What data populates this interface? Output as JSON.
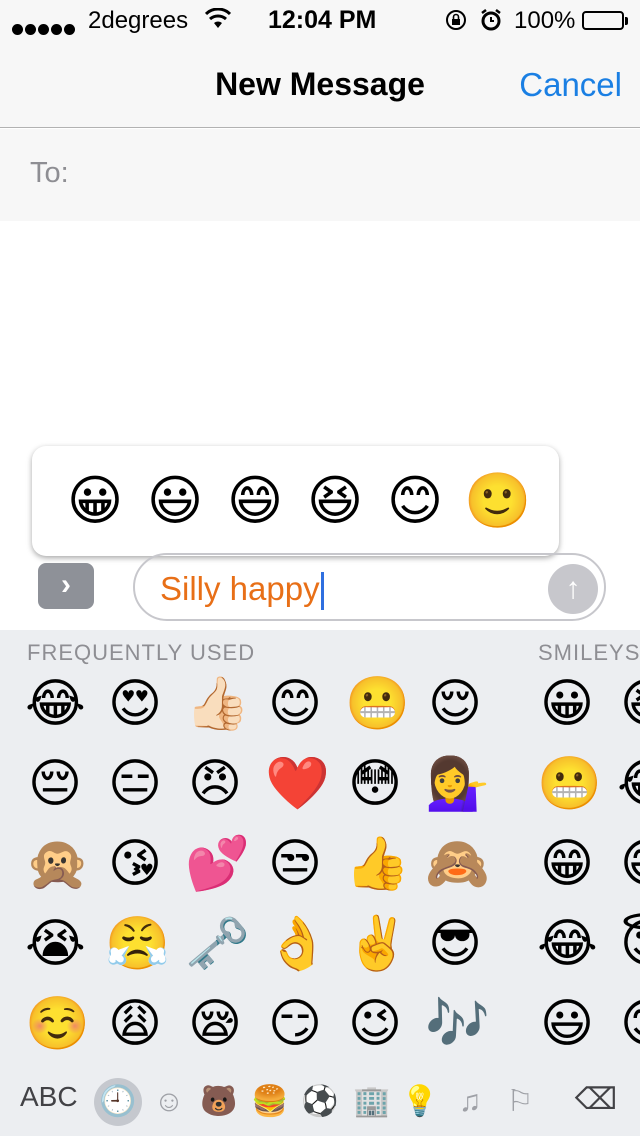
{
  "status_bar": {
    "carrier": "2degrees",
    "time": "12:04 PM",
    "battery": "100%"
  },
  "header": {
    "title": "New Message",
    "cancel_label": "Cancel"
  },
  "recipient": {
    "label": "To:"
  },
  "suggestions": [
    "😀",
    "😃",
    "😄",
    "😆",
    "😊",
    "🙂"
  ],
  "composer": {
    "text": "Silly happy",
    "expand_glyph": "›",
    "send_glyph": "↑"
  },
  "keyboard": {
    "sections": [
      "FREQUENTLY USED",
      "SMILEYS & PEOPLE"
    ],
    "frequently_used": [
      [
        "😂",
        "😍",
        "👍🏻",
        "😊",
        "😬",
        "😌"
      ],
      [
        "😔",
        "😑",
        "😠",
        "❤️",
        "😳",
        "💁‍♀️"
      ],
      [
        "🙊",
        "😘",
        "💕",
        "😒",
        "👍",
        "🙈"
      ],
      [
        "😭",
        "😤",
        "🗝️",
        "👌",
        "✌️",
        "😎"
      ],
      [
        "☺️",
        "😩",
        "😪",
        "😏",
        "😉",
        "🎶"
      ]
    ],
    "smileys_partial": [
      [
        "😀",
        "😆"
      ],
      [
        "😬",
        "😂"
      ],
      [
        "😁",
        "😅"
      ],
      [
        "😂",
        "😇"
      ],
      [
        "😃",
        "😊"
      ]
    ],
    "abc_label": "ABC",
    "categories": [
      "recent-clock-icon",
      "smiley-icon",
      "animal-icon",
      "food-icon",
      "ball-icon",
      "building-icon",
      "lightbulb-icon",
      "symbols-icon",
      "flag-icon"
    ],
    "delete_glyph": "⌫"
  }
}
